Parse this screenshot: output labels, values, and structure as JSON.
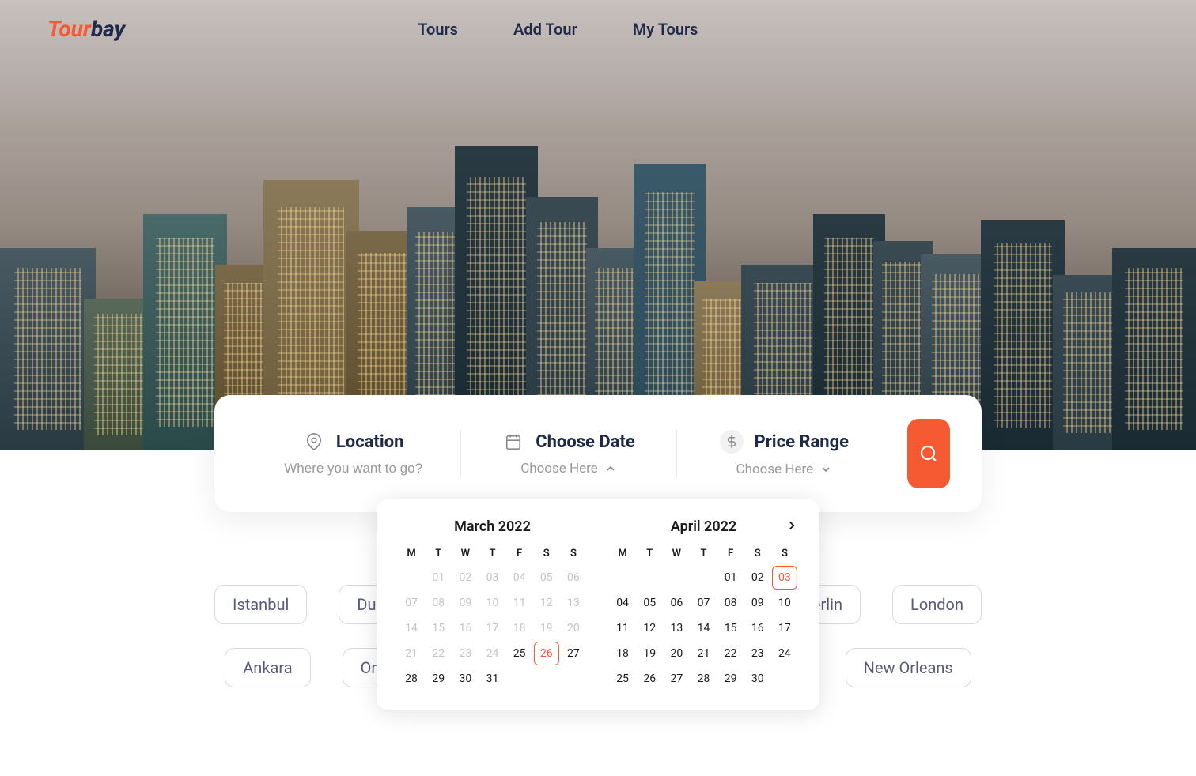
{
  "brand": {
    "part1": "Tour",
    "part2": "bay"
  },
  "nav": {
    "tours": "Tours",
    "add_tour": "Add Tour",
    "my_tours": "My Tours"
  },
  "search": {
    "location": {
      "title": "Location",
      "placeholder": "Where you want to go?"
    },
    "date": {
      "title": "Choose Date",
      "action": "Choose Here"
    },
    "price": {
      "title": "Price Range",
      "action": "Choose Here"
    }
  },
  "datepicker": {
    "month1": {
      "title": "March 2022",
      "weekdays": [
        "M",
        "T",
        "W",
        "T",
        "F",
        "S",
        "S"
      ],
      "days": [
        {
          "n": "01",
          "s": "disabled"
        },
        {
          "n": "02",
          "s": "disabled"
        },
        {
          "n": "03",
          "s": "disabled"
        },
        {
          "n": "04",
          "s": "disabled"
        },
        {
          "n": "05",
          "s": "disabled"
        },
        {
          "n": "06",
          "s": "disabled"
        },
        {
          "n": "07",
          "s": "disabled"
        },
        {
          "n": "08",
          "s": "disabled"
        },
        {
          "n": "09",
          "s": "disabled"
        },
        {
          "n": "10",
          "s": "disabled"
        },
        {
          "n": "11",
          "s": "disabled"
        },
        {
          "n": "12",
          "s": "disabled"
        },
        {
          "n": "13",
          "s": "disabled"
        },
        {
          "n": "14",
          "s": "disabled"
        },
        {
          "n": "15",
          "s": "disabled"
        },
        {
          "n": "16",
          "s": "disabled"
        },
        {
          "n": "17",
          "s": "disabled"
        },
        {
          "n": "18",
          "s": "disabled"
        },
        {
          "n": "19",
          "s": "disabled"
        },
        {
          "n": "20",
          "s": "disabled"
        },
        {
          "n": "21",
          "s": "disabled"
        },
        {
          "n": "22",
          "s": "disabled"
        },
        {
          "n": "23",
          "s": "disabled"
        },
        {
          "n": "24",
          "s": "disabled"
        },
        {
          "n": "25",
          "s": "enabled"
        },
        {
          "n": "26",
          "s": "selected"
        },
        {
          "n": "27",
          "s": "enabled"
        },
        {
          "n": "28",
          "s": "enabled"
        },
        {
          "n": "29",
          "s": "enabled"
        },
        {
          "n": "30",
          "s": "enabled"
        },
        {
          "n": "31",
          "s": "enabled"
        }
      ],
      "leading_empty": 1
    },
    "month2": {
      "title": "April 2022",
      "weekdays": [
        "M",
        "T",
        "W",
        "T",
        "F",
        "S",
        "S"
      ],
      "days": [
        {
          "n": "01",
          "s": "enabled"
        },
        {
          "n": "02",
          "s": "enabled"
        },
        {
          "n": "03",
          "s": "selected"
        },
        {
          "n": "04",
          "s": "enabled"
        },
        {
          "n": "05",
          "s": "enabled"
        },
        {
          "n": "06",
          "s": "enabled"
        },
        {
          "n": "07",
          "s": "enabled"
        },
        {
          "n": "08",
          "s": "enabled"
        },
        {
          "n": "09",
          "s": "enabled"
        },
        {
          "n": "10",
          "s": "enabled"
        },
        {
          "n": "11",
          "s": "enabled"
        },
        {
          "n": "12",
          "s": "enabled"
        },
        {
          "n": "13",
          "s": "enabled"
        },
        {
          "n": "14",
          "s": "enabled"
        },
        {
          "n": "15",
          "s": "enabled"
        },
        {
          "n": "16",
          "s": "enabled"
        },
        {
          "n": "17",
          "s": "enabled"
        },
        {
          "n": "18",
          "s": "enabled"
        },
        {
          "n": "19",
          "s": "enabled"
        },
        {
          "n": "20",
          "s": "enabled"
        },
        {
          "n": "21",
          "s": "enabled"
        },
        {
          "n": "22",
          "s": "enabled"
        },
        {
          "n": "23",
          "s": "enabled"
        },
        {
          "n": "24",
          "s": "enabled"
        },
        {
          "n": "25",
          "s": "enabled"
        },
        {
          "n": "26",
          "s": "enabled"
        },
        {
          "n": "27",
          "s": "enabled"
        },
        {
          "n": "28",
          "s": "enabled"
        },
        {
          "n": "29",
          "s": "enabled"
        },
        {
          "n": "30",
          "s": "enabled"
        }
      ],
      "leading_empty": 4
    }
  },
  "chips": {
    "row1": [
      "Istanbul",
      "Dubai",
      "erlin",
      "London"
    ],
    "row2": [
      "Ankara",
      "Orlando",
      "New Orleans"
    ]
  },
  "colors": {
    "accent": "#f55a33",
    "dark": "#1e2a47"
  }
}
